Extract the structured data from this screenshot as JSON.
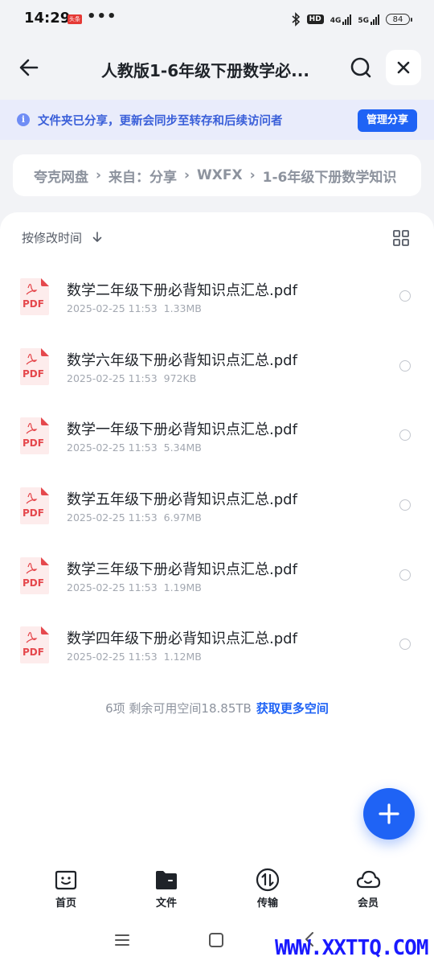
{
  "status_bar": {
    "time": "14:29",
    "badge": "头条",
    "dots": "•••",
    "hd": "HD",
    "net1": "4G",
    "net2": "5G",
    "battery": "84"
  },
  "header": {
    "title": "人教版1-6年级下册数学必...",
    "back_icon": "arrow-left-icon",
    "search_icon": "search-icon",
    "close_icon": "close-icon"
  },
  "banner": {
    "info_icon_text": "i",
    "text": "文件夹已分享，更新会同步至转存和后续访问者",
    "button": "管理分享"
  },
  "breadcrumb": [
    "夸克网盘",
    "来自：分享",
    "WXFX",
    "1-6年级下册数学知识"
  ],
  "list": {
    "sort_label": "按修改时间",
    "files": [
      {
        "name": "数学二年级下册必背知识点汇总.pdf",
        "date": "2025-02-25 11:53",
        "size": "1.33MB",
        "icon_text": "PDF"
      },
      {
        "name": "数学六年级下册必背知识点汇总.pdf",
        "date": "2025-02-25 11:53",
        "size": "972KB",
        "icon_text": "PDF"
      },
      {
        "name": "数学一年级下册必背知识点汇总.pdf",
        "date": "2025-02-25 11:53",
        "size": "5.34MB",
        "icon_text": "PDF"
      },
      {
        "name": "数学五年级下册必背知识点汇总.pdf",
        "date": "2025-02-25 11:53",
        "size": "6.97MB",
        "icon_text": "PDF"
      },
      {
        "name": "数学三年级下册必背知识点汇总.pdf",
        "date": "2025-02-25 11:53",
        "size": "1.19MB",
        "icon_text": "PDF"
      },
      {
        "name": "数学四年级下册必背知识点汇总.pdf",
        "date": "2025-02-25 11:53",
        "size": "1.12MB",
        "icon_text": "PDF"
      }
    ],
    "summary": "6项 剩余可用空间18.85TB",
    "more_space_link": "获取更多空间"
  },
  "bottom_nav": [
    {
      "label": "首页",
      "icon": "home-face-icon"
    },
    {
      "label": "文件",
      "icon": "folder-icon"
    },
    {
      "label": "传输",
      "icon": "transfer-icon"
    },
    {
      "label": "会员",
      "icon": "cloud-icon"
    }
  ],
  "watermark": "WWW.XXTTQ.COM",
  "colors": {
    "accent": "#1f63f5",
    "banner_bg": "#e9ecfb",
    "pdf_red": "#e5484d",
    "page_bg": "#f2f3f6"
  }
}
